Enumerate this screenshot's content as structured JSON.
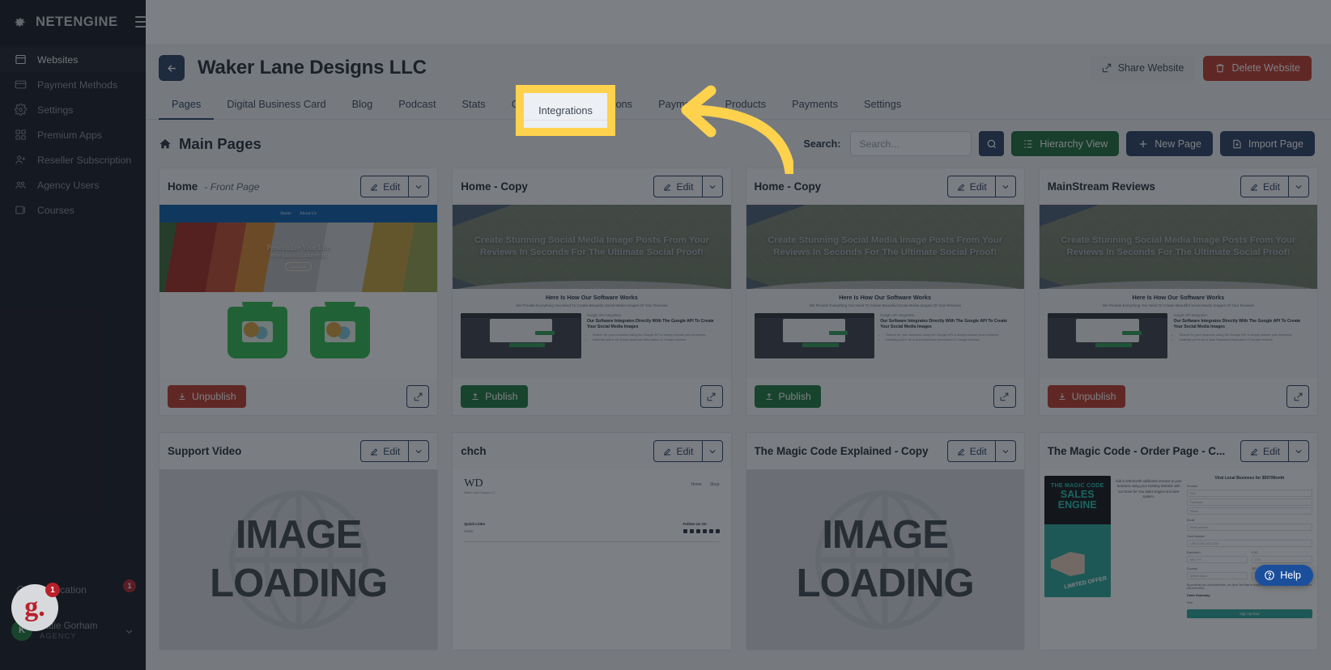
{
  "brand": {
    "name": "NETENGINE",
    "logo_icon": "gear-icon",
    "menu_icon": "hamburger-icon"
  },
  "sidebar": {
    "items": [
      {
        "label": "Websites",
        "icon": "browser-window-icon",
        "active": true
      },
      {
        "label": "Payment Methods",
        "icon": "credit-card-icon",
        "active": false
      },
      {
        "label": "Settings",
        "icon": "gear-icon",
        "active": false
      },
      {
        "label": "Premium Apps",
        "icon": "apps-grid-icon",
        "active": false
      },
      {
        "label": "Reseller Subscription",
        "icon": "user-plus-icon",
        "active": false
      },
      {
        "label": "Agency Users",
        "icon": "users-group-icon",
        "active": false
      },
      {
        "label": "Courses",
        "icon": "book-icon",
        "active": false
      }
    ],
    "notification": {
      "label": "Notification",
      "icon": "bell-icon",
      "count": "1"
    },
    "user": {
      "initial": "K",
      "name": "Katie Gorham",
      "org": "AGENCY",
      "caret_icon": "chevron-down-icon"
    }
  },
  "header": {
    "back_icon": "arrow-left-icon",
    "title": "Waker Lane Designs LLC",
    "share_label": "Share Website",
    "share_icon": "share-icon",
    "delete_label": "Delete Website",
    "delete_icon": "trash-icon"
  },
  "tabs": [
    {
      "label": "Pages",
      "active": true
    },
    {
      "label": "Digital Business Card",
      "active": false
    },
    {
      "label": "Blog",
      "active": false
    },
    {
      "label": "Podcast",
      "active": false
    },
    {
      "label": "Stats",
      "active": false
    },
    {
      "label": "Contacts",
      "active": false
    },
    {
      "label": "Integrations",
      "active": false
    },
    {
      "label": "Payment",
      "active": false
    },
    {
      "label": "Products",
      "active": false
    },
    {
      "label": "Payments",
      "active": false
    },
    {
      "label": "Settings",
      "active": false
    }
  ],
  "section": {
    "home_icon": "home-icon",
    "title": "Main Pages",
    "search_label": "Search:",
    "search_value": "",
    "search_placeholder": "Search...",
    "search_icon": "search-icon",
    "hierarchy_label": "Hierarchy View",
    "hierarchy_icon": "list-tree-icon",
    "new_page_label": "New Page",
    "new_page_icon": "plus-icon",
    "import_label": "Import Page",
    "import_icon": "import-icon"
  },
  "card_common": {
    "edit_label": "Edit",
    "edit_icon": "pencil-square-icon",
    "caret_icon": "chevron-down-icon",
    "external_icon": "external-link-icon",
    "publish_icon": "upload-icon",
    "unpublish_icon": "download-icon"
  },
  "cards": [
    {
      "title": "Home",
      "subtitle": "- Front Page",
      "action": "Unpublish",
      "action_type": "unpublish",
      "thumb": "shirts"
    },
    {
      "title": "Home - Copy",
      "subtitle": "",
      "action": "Publish",
      "action_type": "publish",
      "thumb": "social"
    },
    {
      "title": "Home - Copy",
      "subtitle": "",
      "action": "Publish",
      "action_type": "publish",
      "thumb": "social"
    },
    {
      "title": "MainStream Reviews",
      "subtitle": "",
      "action": "Unpublish",
      "action_type": "unpublish",
      "thumb": "social"
    },
    {
      "title": "Support Video",
      "subtitle": "",
      "action": "",
      "action_type": "",
      "thumb": "loading"
    },
    {
      "title": "chch",
      "subtitle": "",
      "action": "",
      "action_type": "",
      "thumb": "chch"
    },
    {
      "title": "The Magic Code Explained - Copy",
      "subtitle": "",
      "action": "",
      "action_type": "",
      "thumb": "loading"
    },
    {
      "title": "The Magic Code - Order Page - C...",
      "subtitle": "",
      "action": "",
      "action_type": "",
      "thumb": "magic"
    }
  ],
  "thumb_social": {
    "hero": "Create Stunning Social Media Image Posts From Your Reviews In Seconds For The Ultimate Social Proof!",
    "section_title": "Here Is How Our Software Works",
    "section_sub": "We Provide Everything You Need To Create Beautiful Social Media Images Of Your Reviews",
    "feature_kicker": "Google API Integration",
    "feature_title": "Our Software Integrates Directly With The Google API To Create Your Social Media Images",
    "bullet1": "Search for your business using the Google API & simply choose your business.",
    "bullet2": "Instantly pull in all of your business information & Google reviews."
  },
  "thumb_shirts": {
    "nav1": "Home",
    "nav2": "About Us",
    "hero_title": "Personalize Your Life",
    "hero_sub": "NEW ARRIVAL ARE HERE",
    "hero_cta": "Shop Now"
  },
  "thumb_loading": {
    "line1": "IMAGE",
    "line2": "LOADING"
  },
  "thumb_chch": {
    "logo": "WD",
    "logo_sub": "Waker Lane Designs LLC",
    "nav1": "Home",
    "nav2": "Shop",
    "col1_title": "Quick Links",
    "col1_item": "Home",
    "col2_title": "Follow Us On"
  },
  "thumb_magic": {
    "poster_line1": "THE MAGIC CODE",
    "poster_line2": "SALES ENGINE",
    "poster_badge": "LIMITED OFFER",
    "poster_caption": "Add 5-10K/month additional revenue to your business using your Existing Website with our Done-for-You Sales Engine and alert system.",
    "form_title": "Viral Local Business for $597/Month",
    "product_label": "Product",
    "product_value": "Test",
    "fullname_placeholder": "Full Name",
    "phone_placeholder": "Phone",
    "email_label": "Email",
    "email_placeholder": "Email address",
    "card_label": "Card Number",
    "card_placeholder": "1234 1234 1234 1234",
    "exp_label": "Expiration",
    "exp_placeholder": "MM / YY",
    "cvc_label": "CVC",
    "cvc_placeholder": "CVC",
    "country_label": "Country",
    "country_value": "United States",
    "zip_label": "ZIP",
    "zip_value": "12345",
    "consent": "By providing your card information, you allow Test Bulb to charge your card for future payments in accordance with their terms.",
    "summary_label": "Order Summary",
    "summary_item": "Test",
    "cta": "Sign Up Now"
  },
  "overlay": {
    "highlight_tab": "Integrations",
    "highlight_color": "#ffd24d",
    "arrow_color": "#ffd24d"
  },
  "help": {
    "label": "Help",
    "icon": "question-circle-icon"
  },
  "gbadge": {
    "letter": "g.",
    "count": "1"
  }
}
